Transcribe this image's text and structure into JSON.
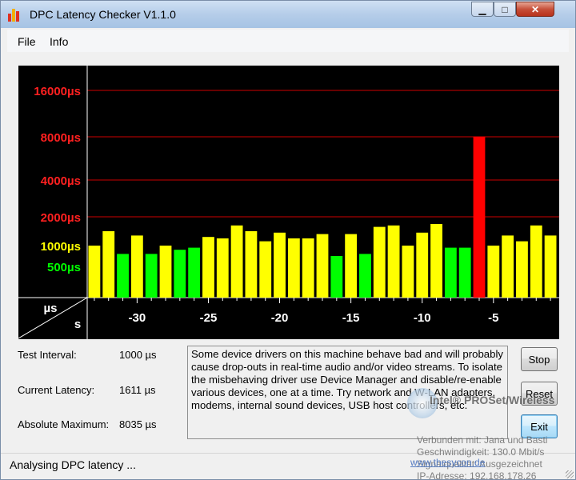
{
  "window": {
    "title": "DPC Latency Checker V1.1.0"
  },
  "titlebar_buttons": {
    "minimize": "▁",
    "maximize": "□",
    "close": "✕"
  },
  "menu": [
    {
      "label": "File"
    },
    {
      "label": "Info"
    }
  ],
  "chart_data": {
    "type": "bar",
    "ylabel": "µs",
    "xlabel": "s",
    "y_tick_labels": [
      "16000µs",
      "8000µs",
      "4000µs",
      "2000µs",
      "1000µs",
      "500µs"
    ],
    "x_tick_labels": [
      "-30",
      "-25",
      "-20",
      "-15",
      "-10",
      "-5"
    ],
    "x_range": [
      -33,
      -1
    ],
    "x": [
      -33,
      -32,
      -31,
      -30,
      -29,
      -28,
      -27,
      -26,
      -25,
      -24,
      -23,
      -22,
      -21,
      -20,
      -19,
      -18,
      -17,
      -16,
      -15,
      -14,
      -13,
      -12,
      -11,
      -10,
      -9,
      -8,
      -7,
      -6,
      -5,
      -4,
      -3,
      -2,
      -1
    ],
    "values": [
      1000,
      1500,
      800,
      1350,
      800,
      1000,
      900,
      950,
      1300,
      1250,
      1700,
      1500,
      1150,
      1450,
      1250,
      1250,
      1400,
      750,
      1400,
      800,
      1650,
      1700,
      1000,
      1450,
      1750,
      950,
      950,
      8035,
      1000,
      1350,
      1150,
      1700,
      1350
    ],
    "color_thresholds": {
      "green_below": 1000,
      "red_from": 2000
    },
    "colors": {
      "green": "#00ff00",
      "yellow": "#ffff00",
      "red": "#ff0000",
      "background": "#000000",
      "grid": "#cc0000"
    }
  },
  "stats": [
    {
      "label": "Test Interval:",
      "value": "1000 µs"
    },
    {
      "label": "Current Latency:",
      "value": "1611 µs"
    },
    {
      "label": "Absolute Maximum:",
      "value": "8035 µs"
    }
  ],
  "message": "Some device drivers on this machine behave bad and will probably cause drop-outs in real-time audio and/or video streams. To isolate the misbehaving driver use Device Manager and disable/re-enable various devices, one at a time. Try network and W-LAN adapters, modems, internal sound devices, USB host controllers, etc.",
  "buttons": {
    "stop": "Stop",
    "reset": "Reset",
    "exit": "Exit"
  },
  "status": "Analysing DPC latency ...",
  "wifi_notification": {
    "title": "Intel® PROSet/Wireless",
    "connected": "Verbunden mit: Jana und Basti",
    "speed": "Geschwindigkeit: 130.0 Mbit/s",
    "quality": "Signalqualität: Ausgezeichnet",
    "ip": "IP-Adresse: 192.168.178.26",
    "link": "www.thesycon.de"
  }
}
